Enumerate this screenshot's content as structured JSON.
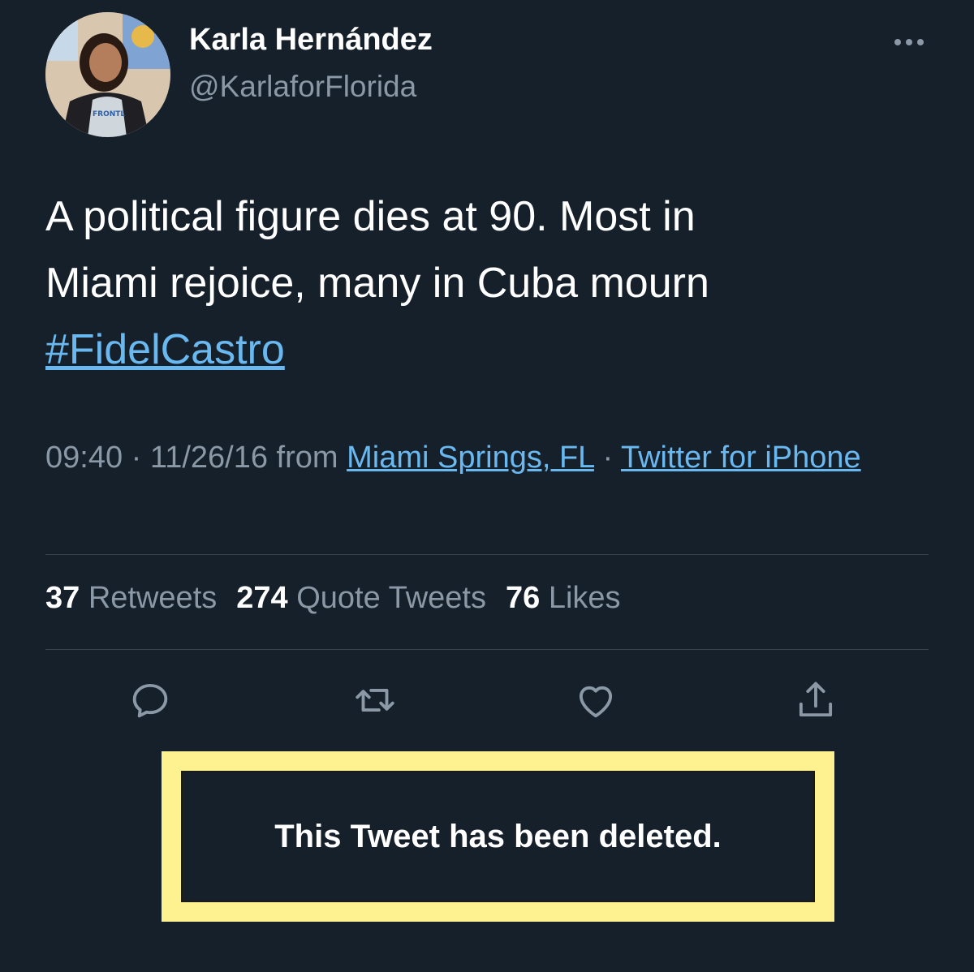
{
  "author": {
    "display_name": "Karla Hernández",
    "handle": "@KarlaforFlorida"
  },
  "tweet": {
    "text_line1": "A political figure dies at 90. Most in",
    "text_line2": "Miami rejoice, many in Cuba mourn",
    "hashtag": "#FidelCastro"
  },
  "meta": {
    "time": "09:40",
    "separator": "·",
    "date": "11/26/16",
    "from_label": "from",
    "location": "Miami Springs, FL",
    "source": "Twitter for iPhone"
  },
  "stats": {
    "retweets_count": "37",
    "retweets_label": "Retweets",
    "quotes_count": "274",
    "quotes_label": "Quote Tweets",
    "likes_count": "76",
    "likes_label": "Likes"
  },
  "actions": {
    "reply_icon": "reply-icon",
    "retweet_icon": "retweet-icon",
    "like_icon": "heart-icon",
    "share_icon": "share-icon"
  },
  "overlay": {
    "deleted_message": "This Tweet has been deleted."
  },
  "colors": {
    "background": "#15202b",
    "link": "#6ab8f0",
    "muted": "#8b98a5",
    "highlight": "#fdf28f"
  }
}
